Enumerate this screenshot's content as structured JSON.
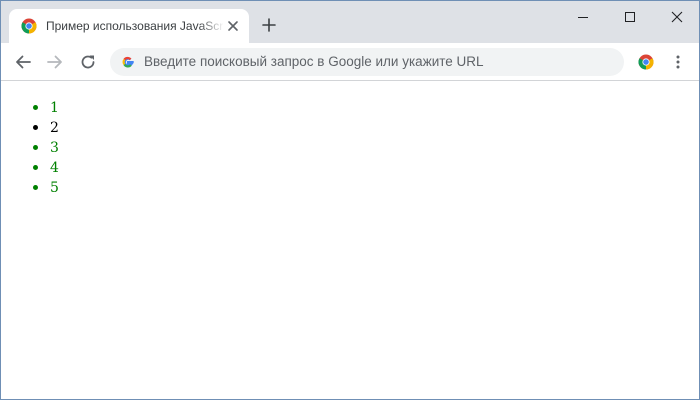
{
  "tab": {
    "title": "Пример использования JavaScript"
  },
  "omnibox": {
    "placeholder": "Введите поисковый запрос в Google или укажите URL"
  },
  "list": {
    "items": [
      {
        "text": "1",
        "color": "#008000"
      },
      {
        "text": "2",
        "color": "#000000"
      },
      {
        "text": "3",
        "color": "#008000"
      },
      {
        "text": "4",
        "color": "#008000"
      },
      {
        "text": "5",
        "color": "#008000"
      }
    ]
  },
  "icons": {
    "favicon": "chrome-icon",
    "close": "close-icon",
    "new_tab": "plus-icon",
    "minimize": "minimize-icon",
    "maximize": "maximize-icon",
    "window_close": "window-close-icon",
    "back": "back-arrow-icon",
    "forward": "forward-arrow-icon",
    "reload": "reload-icon",
    "google": "google-icon",
    "extension": "chrome-icon",
    "menu": "kebab-menu-icon"
  },
  "colors": {
    "tabstrip": "#dee1e6",
    "omnibox": "#f1f3f4",
    "list_accent": "#008000"
  }
}
